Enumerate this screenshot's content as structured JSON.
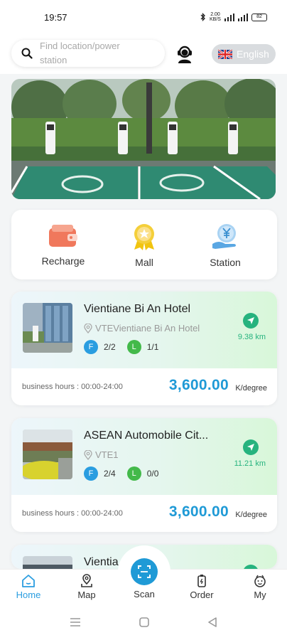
{
  "status_bar": {
    "time": "19:57",
    "network_speed": "2.00\nKB/S",
    "battery": "82"
  },
  "search": {
    "placeholder": "Find location/power station"
  },
  "language": {
    "label": "English",
    "flag": "uk-flag"
  },
  "menu": [
    {
      "label": "Recharge",
      "icon": "wallet-icon"
    },
    {
      "label": "Mall",
      "icon": "medal-icon"
    },
    {
      "label": "Station",
      "icon": "kip-coin-hand-icon"
    }
  ],
  "stations": [
    {
      "name": "Vientiane Bi An Hotel",
      "address": "VTEVientiane Bi An Hotel",
      "fast": "2/2",
      "slow": "1/1",
      "distance": "9.38 km",
      "hours": "business hours : 00:00-24:00",
      "price": "3,600.00",
      "unit": "K/degree"
    },
    {
      "name": "ASEAN Automobile Cit...",
      "address": "VTE1",
      "fast": "2/4",
      "slow": "0/0",
      "distance": "11.21 km",
      "hours": "business hours : 00:00-24:00",
      "price": "3,600.00",
      "unit": "K/degree"
    },
    {
      "name": "Vientia"
    }
  ],
  "chips": {
    "fast": "F",
    "slow": "L"
  },
  "bottom_nav": {
    "home": "Home",
    "map": "Map",
    "scan": "Scan",
    "order": "Order",
    "my": "My"
  },
  "colors": {
    "accent": "#1f9ad6",
    "green": "#26b37e",
    "fast_chip": "#2a9de0",
    "slow_chip": "#43b94a"
  }
}
